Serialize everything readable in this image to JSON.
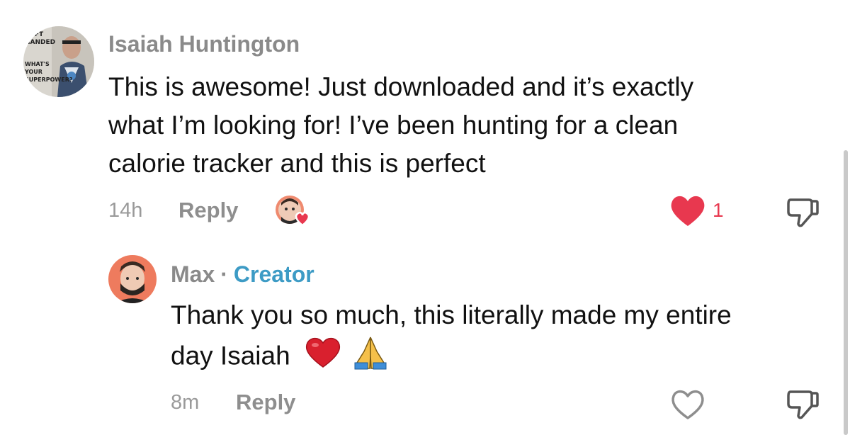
{
  "comment": {
    "author": "Isaiah Huntington",
    "text_lines": [
      "This is awesome! Just downloaded and it’s exactly",
      "what I’m looking for! I’ve been hunting for a clean",
      "calorie tracker and this is perfect"
    ],
    "avatar_text": [
      "LEFT",
      "HANDED",
      "WHAT'S",
      "YOUR",
      "SUPERPOWER?"
    ],
    "time": "14h",
    "reply_label": "Reply",
    "like_count": "1",
    "liked_by_creator": true,
    "liked": true
  },
  "reply": {
    "author": "Max",
    "separator": "·",
    "badge": "Creator",
    "text_lines": [
      "Thank you so much, this literally made my entire",
      "day Isaiah"
    ],
    "emojis": [
      "red-heart",
      "folded-hands"
    ],
    "time": "8m",
    "reply_label": "Reply",
    "liked": false
  },
  "colors": {
    "like_red": "#e8384f",
    "creator_blue": "#3d9bc5",
    "meta_gray": "#8e8e8e"
  }
}
